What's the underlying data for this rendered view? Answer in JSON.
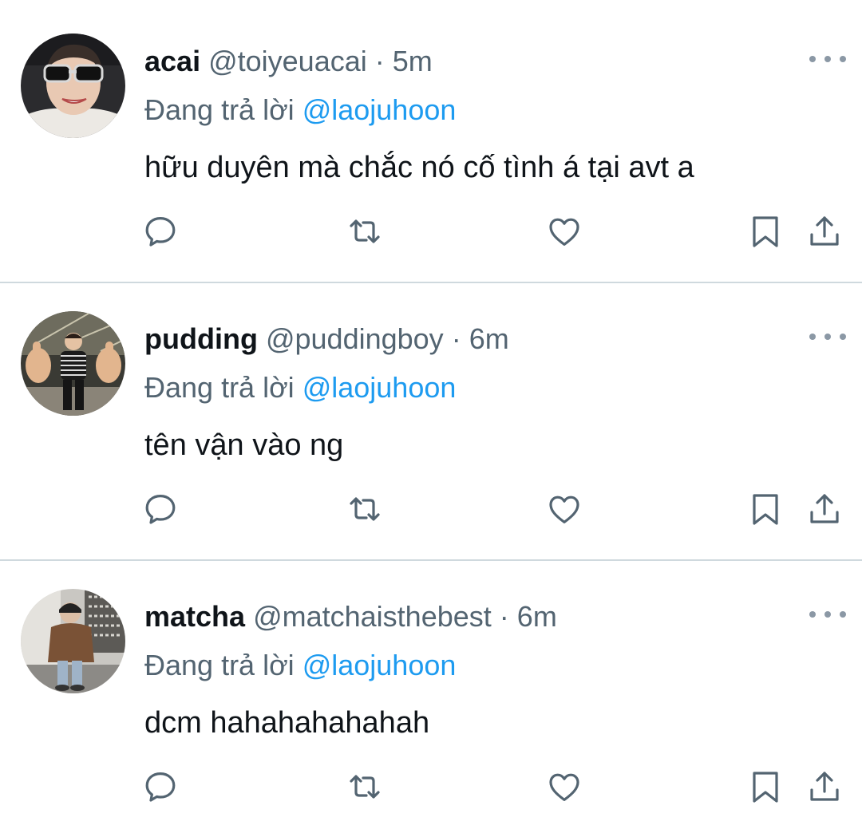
{
  "colors": {
    "text_primary": "#0f1419",
    "text_secondary": "#536471",
    "link": "#1d9bf0",
    "divider": "#cfd9de",
    "icon": "#536471"
  },
  "icons": {
    "reply": "reply-icon",
    "retweet": "retweet-icon",
    "like": "heart-icon",
    "bookmark": "bookmark-icon",
    "share": "share-icon",
    "more": "more-icon"
  },
  "tweets": [
    {
      "display_name": "acai",
      "handle": "@toiyeuacai",
      "separator": "·",
      "time": "5m",
      "reply_prefix": "Đang trả lời",
      "reply_target": "@laojuhoon",
      "text": "hữu duyên mà chắc nó cố tình á tại avt a"
    },
    {
      "display_name": "pudding",
      "handle": "@puddingboy",
      "separator": "·",
      "time": "6m",
      "reply_prefix": "Đang trả lời",
      "reply_target": "@laojuhoon",
      "text": "tên vận vào ng"
    },
    {
      "display_name": "matcha",
      "handle": "@matchaisthebest",
      "separator": "·",
      "time": "6m",
      "reply_prefix": "Đang trả lời",
      "reply_target": "@laojuhoon",
      "text": "dcm hahahahahahah"
    }
  ]
}
